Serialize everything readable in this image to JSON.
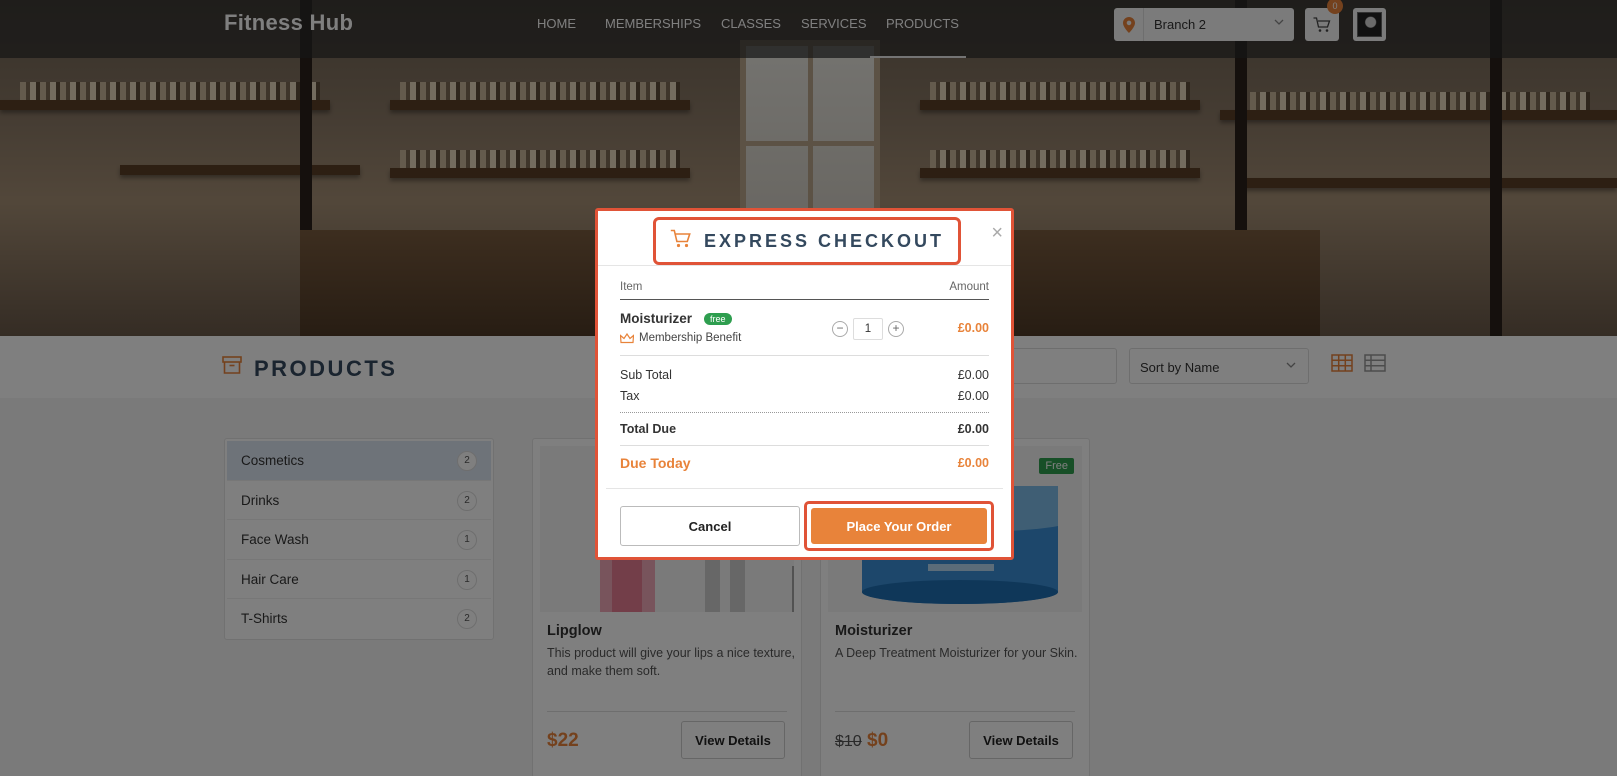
{
  "header": {
    "brand": "Fitness Hub",
    "nav": [
      "HOME",
      "MEMBERSHIPS",
      "CLASSES",
      "SERVICES",
      "PRODUCTS"
    ],
    "active_nav": "PRODUCTS",
    "branch": "Branch 2",
    "cart_count": "0"
  },
  "products_bar": {
    "title": "PRODUCTS",
    "sort_label": "Sort by Name"
  },
  "sidebar": {
    "categories": [
      {
        "name": "Cosmetics",
        "count": "2",
        "active": true
      },
      {
        "name": "Drinks",
        "count": "2"
      },
      {
        "name": "Face Wash",
        "count": "1"
      },
      {
        "name": "Hair Care",
        "count": "1"
      },
      {
        "name": "T-Shirts",
        "count": "2"
      }
    ]
  },
  "products": [
    {
      "title": "Lipglow",
      "description": "This product will give your lips a nice texture, and make them soft.",
      "price": "$22",
      "button": "View Details"
    },
    {
      "title": "Moisturizer",
      "description": "A Deep Treatment Moisturizer for your Skin.",
      "old_price": "$10",
      "price": "$0",
      "badge": "Free",
      "button": "View Details"
    }
  ],
  "modal": {
    "title": "EXPRESS CHECKOUT",
    "close": "×",
    "col_item": "Item",
    "col_amount": "Amount",
    "item": {
      "name": "Moisturizer",
      "tag": "free",
      "benefit": "Membership Benefit",
      "qty": "1",
      "qty_minus": "−",
      "qty_plus": "+",
      "amount": "£0.00"
    },
    "sub_total_label": "Sub Total",
    "sub_total": "£0.00",
    "tax_label": "Tax",
    "tax": "£0.00",
    "total_due_label": "Total Due",
    "total_due": "£0.00",
    "due_today_label": "Due Today",
    "due_today": "£0.00",
    "cancel": "Cancel",
    "place_order": "Place Your Order"
  },
  "colors": {
    "accent": "#e8833a",
    "highlight": "#e05337",
    "title": "#34495e",
    "free_green": "#2e9e4f"
  }
}
